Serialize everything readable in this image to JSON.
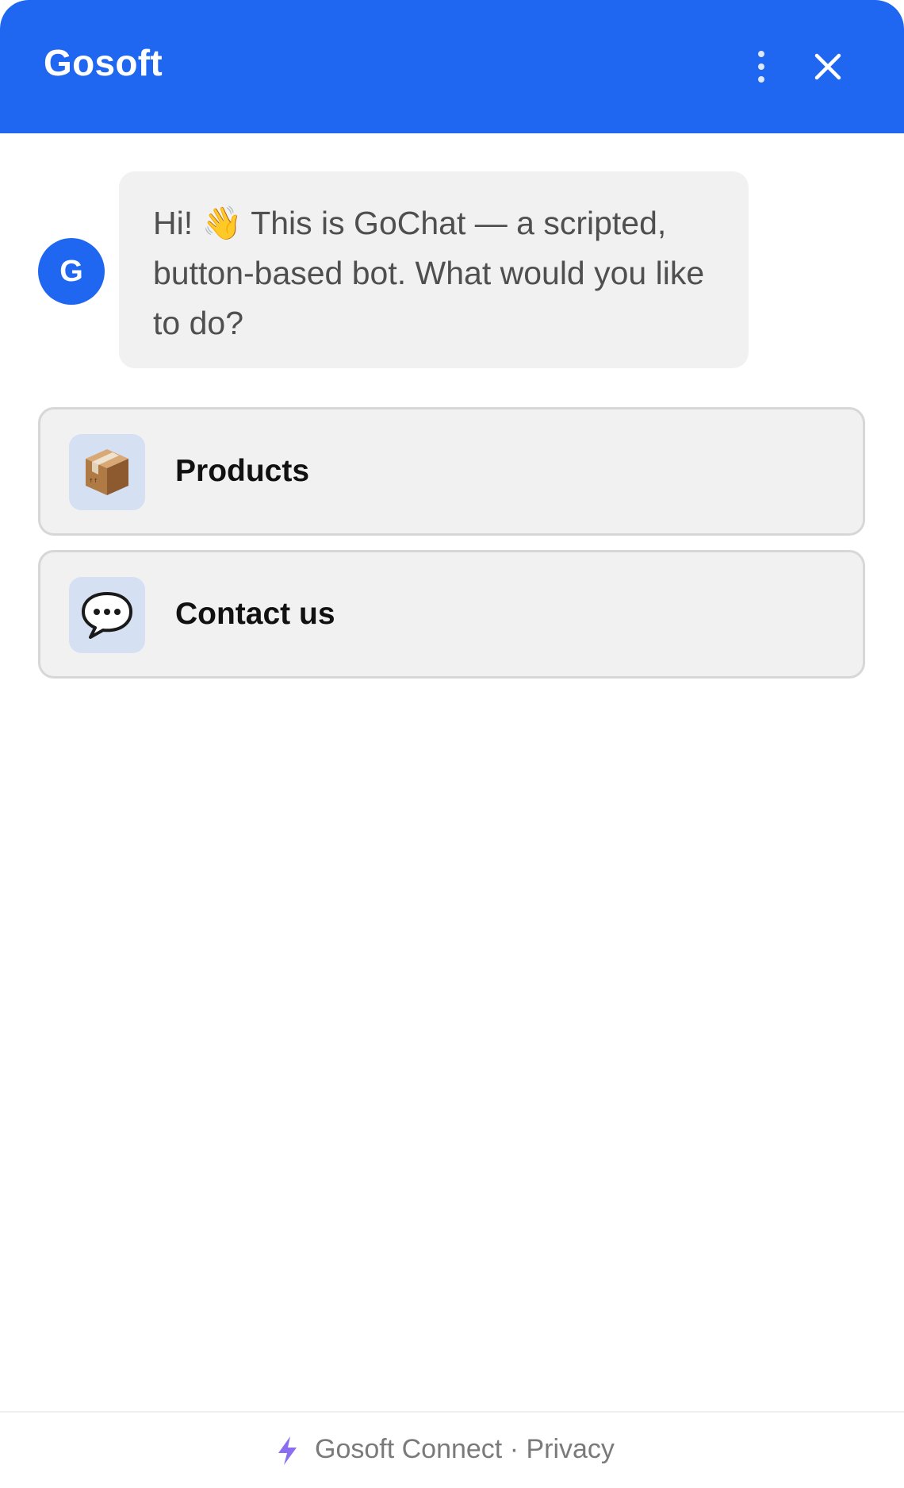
{
  "header": {
    "brand": "Gosoft"
  },
  "chat": {
    "avatar_letter": "G",
    "greeting": "Hi! 👋 This is GoChat — a scripted, button-based bot. What would you like to do?"
  },
  "options": [
    {
      "icon": "package-icon",
      "label": "Products"
    },
    {
      "icon": "speech-bubble-icon",
      "label": "Contact us"
    }
  ],
  "footer": {
    "brand_link": "Gosoft Connect",
    "separator": " · ",
    "privacy_link": "Privacy"
  },
  "colors": {
    "accent": "#1f66f0",
    "bubble_bg": "#f1f1f1",
    "icon_tile_bg": "#d5e0f3",
    "bolt": "#8b6ef0"
  }
}
